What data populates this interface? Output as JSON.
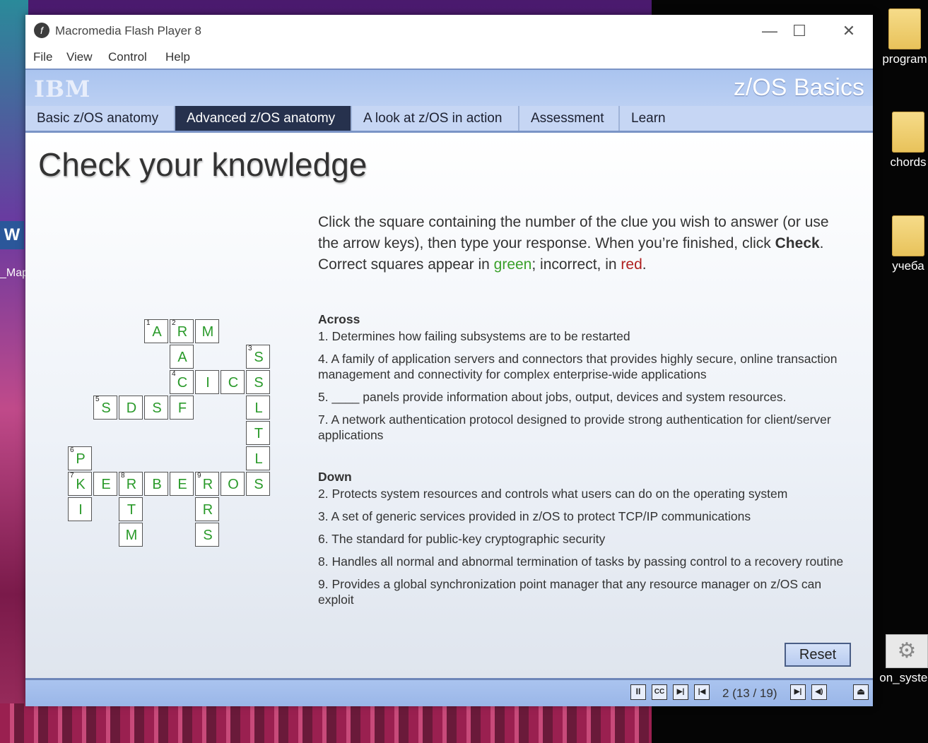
{
  "window": {
    "title": "Macromedia Flash Player 8",
    "minimize": "—",
    "maximize": "☐",
    "close": "✕"
  },
  "menu": [
    "File",
    "View",
    "Control",
    "Help"
  ],
  "header": {
    "logo": "IBM",
    "course_title": "z/OS Basics"
  },
  "tabs": [
    {
      "label": "Basic z/OS anatomy",
      "active": false
    },
    {
      "label": "Advanced z/OS anatomy",
      "active": true
    },
    {
      "label": "A look at z/OS in action",
      "active": false
    },
    {
      "label": "Assessment",
      "active": false
    },
    {
      "label": "Learn more",
      "active": false
    }
  ],
  "page_title": "Check your knowledge",
  "instructions": {
    "part1": "Click the square containing the number of the clue you wish to answer (or use the arrow keys), then type your response. When you’re finished, click ",
    "bold": "Check",
    "part2": ". Correct squares appear in ",
    "green": "green",
    "part3": "; incorrect, in ",
    "red": "red",
    "part4": "."
  },
  "clues": {
    "across_heading": "Across",
    "across": [
      "1. Determines how failing subsystems are to be restarted",
      "4. A family of application servers and connectors that provides highly secure, online transaction management and connectivity for complex enterprise-wide applications",
      "5. ____ panels provide information about jobs, output, devices and system resources.",
      "7. A network authentication protocol designed to provide strong authentication for client/server applications"
    ],
    "down_heading": "Down",
    "down": [
      "2. Protects system resources and controls what users can do on the operating system",
      "3. A set of generic services provided in z/OS to protect TCP/IP communications",
      "6. The standard for public-key cryptographic security",
      "8. Handles all normal and abnormal termination of tasks by passing control to a recovery routine",
      "9. Provides a global synchronization point manager that any resource manager on z/OS can exploit"
    ]
  },
  "crossword": [
    {
      "row": 0,
      "col": 3,
      "letter": "A",
      "num": "1"
    },
    {
      "row": 0,
      "col": 4,
      "letter": "R",
      "num": "2"
    },
    {
      "row": 0,
      "col": 5,
      "letter": "M",
      "num": ""
    },
    {
      "row": 1,
      "col": 4,
      "letter": "A",
      "num": ""
    },
    {
      "row": 1,
      "col": 7,
      "letter": "S",
      "num": "3"
    },
    {
      "row": 2,
      "col": 4,
      "letter": "C",
      "num": "4"
    },
    {
      "row": 2,
      "col": 5,
      "letter": "I",
      "num": ""
    },
    {
      "row": 2,
      "col": 6,
      "letter": "C",
      "num": ""
    },
    {
      "row": 2,
      "col": 7,
      "letter": "S",
      "num": ""
    },
    {
      "row": 3,
      "col": 1,
      "letter": "S",
      "num": "5"
    },
    {
      "row": 3,
      "col": 2,
      "letter": "D",
      "num": ""
    },
    {
      "row": 3,
      "col": 3,
      "letter": "S",
      "num": ""
    },
    {
      "row": 3,
      "col": 4,
      "letter": "F",
      "num": ""
    },
    {
      "row": 3,
      "col": 7,
      "letter": "L",
      "num": ""
    },
    {
      "row": 4,
      "col": 7,
      "letter": "T",
      "num": ""
    },
    {
      "row": 5,
      "col": 0,
      "letter": "P",
      "num": "6"
    },
    {
      "row": 5,
      "col": 7,
      "letter": "L",
      "num": ""
    },
    {
      "row": 6,
      "col": 0,
      "letter": "K",
      "num": "7"
    },
    {
      "row": 6,
      "col": 1,
      "letter": "E",
      "num": ""
    },
    {
      "row": 6,
      "col": 2,
      "letter": "R",
      "num": "8"
    },
    {
      "row": 6,
      "col": 3,
      "letter": "B",
      "num": ""
    },
    {
      "row": 6,
      "col": 4,
      "letter": "E",
      "num": ""
    },
    {
      "row": 6,
      "col": 5,
      "letter": "R",
      "num": "9"
    },
    {
      "row": 6,
      "col": 6,
      "letter": "O",
      "num": ""
    },
    {
      "row": 6,
      "col": 7,
      "letter": "S",
      "num": ""
    },
    {
      "row": 7,
      "col": 0,
      "letter": "I",
      "num": ""
    },
    {
      "row": 7,
      "col": 2,
      "letter": "T",
      "num": ""
    },
    {
      "row": 7,
      "col": 5,
      "letter": "R",
      "num": ""
    },
    {
      "row": 8,
      "col": 2,
      "letter": "M",
      "num": ""
    },
    {
      "row": 8,
      "col": 5,
      "letter": "S",
      "num": ""
    }
  ],
  "reset_label": "Reset",
  "footer": {
    "controls": [
      "pause-icon",
      "cc-icon",
      "play-step-icon",
      "rewind-icon"
    ],
    "page_counter": "2 (13 / 19)",
    "right_controls": [
      "next-icon",
      "volume-icon"
    ],
    "eject": "eject-icon",
    "labels": {
      "pause": "II",
      "cc": "CC",
      "play": "▶|",
      "rewind": "|◀",
      "next": "▶|",
      "volume": "◀)",
      "eject": "⏏"
    }
  },
  "desktop": {
    "icons": [
      "program",
      "chords",
      "учеба",
      "on_systen"
    ],
    "word_label": "_Map"
  }
}
